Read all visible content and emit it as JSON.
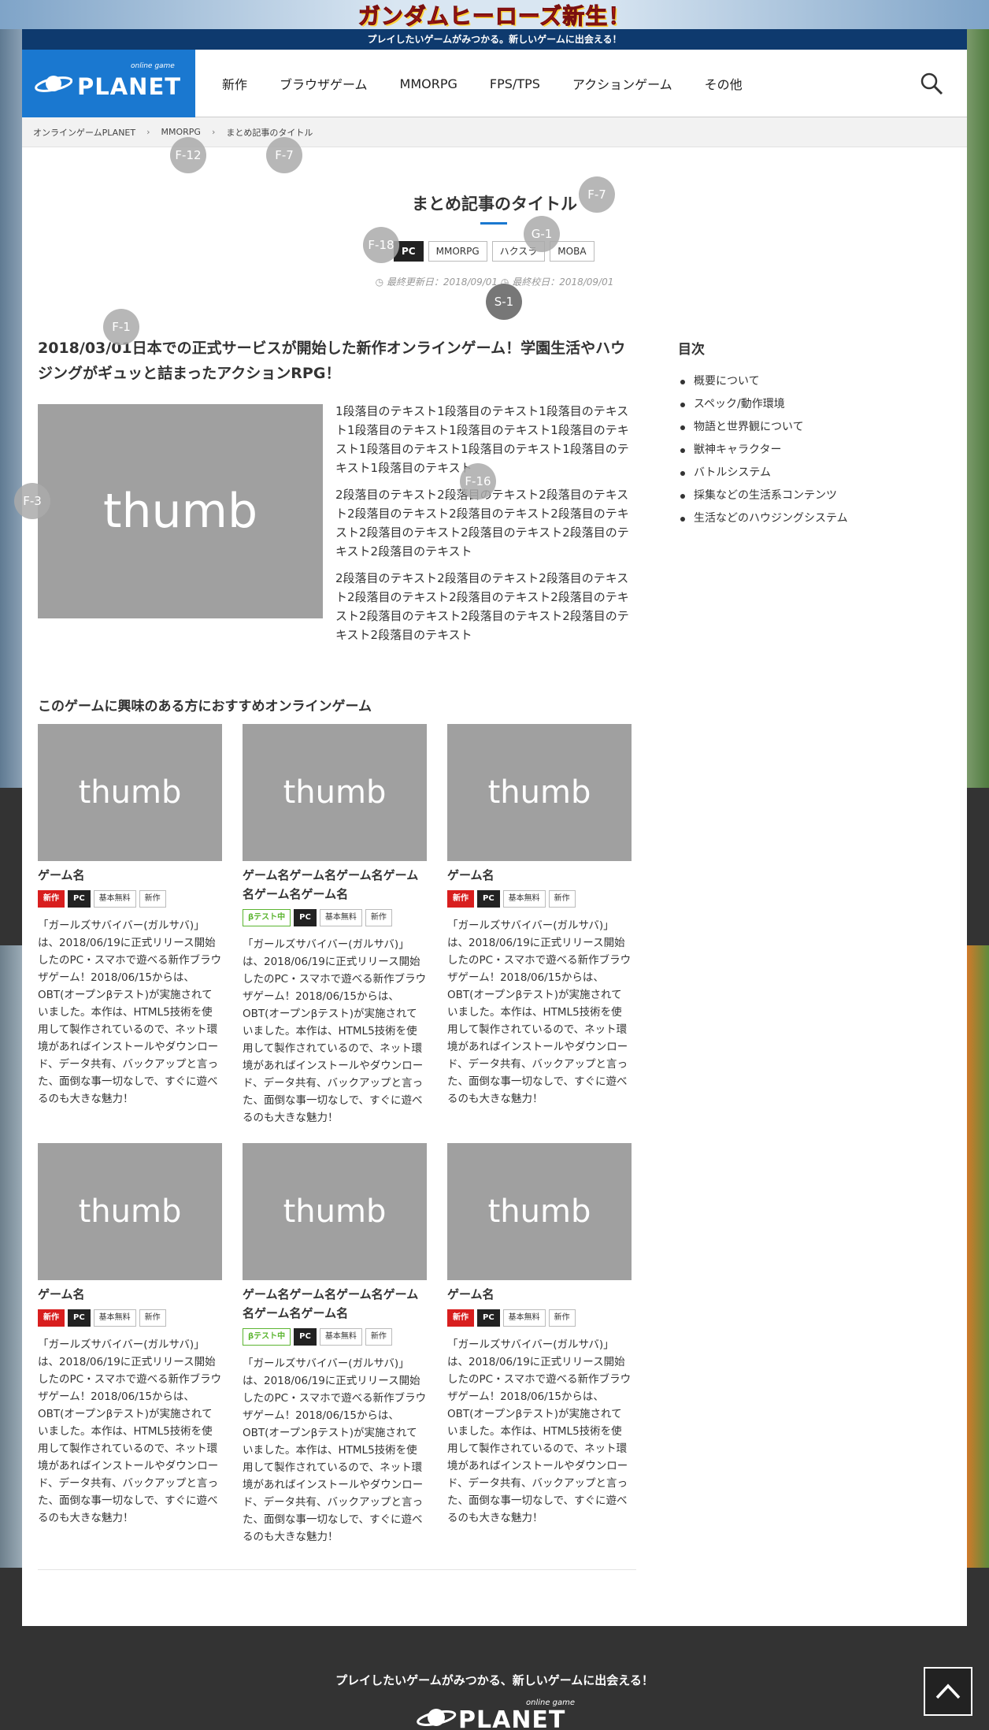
{
  "banner": {
    "text": "ガンダムヒーローズ新生！"
  },
  "tagline": "プレイしたいゲームがみつかる。新しいゲームに出会える！",
  "logo": {
    "sub": "online game",
    "text": "PLANET"
  },
  "nav": [
    "新作",
    "ブラウザゲーム",
    "MMORPG",
    "FPS/TPS",
    "アクションゲーム",
    "その他"
  ],
  "breadcrumb": [
    "オンラインゲームPLANET",
    "MMORPG",
    "まとめ記事のタイトル"
  ],
  "badges": [
    "F-12",
    "F-7",
    "F-7",
    "F-18",
    "G-1",
    "S-1",
    "F-1",
    "F-3",
    "F-16"
  ],
  "article": {
    "title": "まとめ記事のタイトル",
    "tags": [
      "PC",
      "MMORPG",
      "ハクスラ",
      "MOBA"
    ],
    "updated": "最終更新日：2018/09/01",
    "proofread": "最終校日：2018/09/01",
    "lead": "2018/03/01日本での正式サービスが開始した新作オンラインゲーム！学園生活やハウジングがギュッと詰まったアクションRPG！",
    "thumb": "thumb",
    "paragraphs": [
      "1段落目のテキスト1段落目のテキスト1段落目のテキスト1段落目のテキスト1段落目のテキスト1段落目のテキスト1段落目のテキスト1段落目のテキスト1段落目のテキスト1段落目のテキスト",
      "2段落目のテキスト2段落目のテキスト2段落目のテキスト2段落目のテキスト2段落目のテキスト2段落目のテキスト2段落目のテキスト2段落目のテキスト2段落目のテキスト2段落目のテキスト",
      "2段落目のテキスト2段落目のテキスト2段落目のテキスト2段落目のテキスト2段落目のテキスト2段落目のテキスト2段落目のテキスト2段落目のテキスト2段落目のテキスト2段落目のテキスト"
    ]
  },
  "toc": {
    "heading": "目次",
    "items": [
      "概要について",
      "スペック/動作環境",
      "物語と世界観について",
      "獣神キャラクター",
      "バトルシステム",
      "採集などの生活系コンテンツ",
      "生活などのハウジングシステム"
    ]
  },
  "recommend": {
    "heading": "このゲームに興味のある方におすすめオンラインゲーム",
    "cards": [
      {
        "thumb": "thumb",
        "name": "ゲーム名",
        "tags": [
          "新作",
          "PC",
          "基本無料",
          "新作"
        ],
        "desc": "「ガールズサバイバー(ガルサバ)」は、2018/06/19に正式リリース開始したのPC・スマホで遊べる新作ブラウザゲーム！2018/06/15からは、OBT(オープンβテスト)が実施されていました。本作は、HTML5技術を使用して製作されているので、ネット環境があればインストールやダウンロード、データ共有、バックアップと言った、面倒な事一切なしで、すぐに遊べるのも大きな魅力！"
      },
      {
        "thumb": "thumb",
        "name": "ゲーム名ゲーム名ゲーム名ゲーム名ゲーム名ゲーム名",
        "tags": [
          "βテスト中",
          "PC",
          "基本無料",
          "新作"
        ],
        "desc": "「ガールズサバイバー(ガルサバ)」は、2018/06/19に正式リリース開始したのPC・スマホで遊べる新作ブラウザゲーム！2018/06/15からは、OBT(オープンβテスト)が実施されていました。本作は、HTML5技術を使用して製作されているので、ネット環境があればインストールやダウンロード、データ共有、バックアップと言った、面倒な事一切なしで、すぐに遊べるのも大きな魅力！"
      },
      {
        "thumb": "thumb",
        "name": "ゲーム名",
        "tags": [
          "新作",
          "PC",
          "基本無料",
          "新作"
        ],
        "desc": "「ガールズサバイバー(ガルサバ)」は、2018/06/19に正式リリース開始したのPC・スマホで遊べる新作ブラウザゲーム！2018/06/15からは、OBT(オープンβテスト)が実施されていました。本作は、HTML5技術を使用して製作されているので、ネット環境があればインストールやダウンロード、データ共有、バックアップと言った、面倒な事一切なしで、すぐに遊べるのも大きな魅力！"
      },
      {
        "thumb": "thumb",
        "name": "ゲーム名",
        "tags": [
          "新作",
          "PC",
          "基本無料",
          "新作"
        ],
        "desc": "「ガールズサバイバー(ガルサバ)」は、2018/06/19に正式リリース開始したのPC・スマホで遊べる新作ブラウザゲーム！2018/06/15からは、OBT(オープンβテスト)が実施されていました。本作は、HTML5技術を使用して製作されているので、ネット環境があればインストールやダウンロード、データ共有、バックアップと言った、面倒な事一切なしで、すぐに遊べるのも大きな魅力！"
      },
      {
        "thumb": "thumb",
        "name": "ゲーム名ゲーム名ゲーム名ゲーム名ゲーム名ゲーム名",
        "tags": [
          "βテスト中",
          "PC",
          "基本無料",
          "新作"
        ],
        "desc": "「ガールズサバイバー(ガルサバ)」は、2018/06/19に正式リリース開始したのPC・スマホで遊べる新作ブラウザゲーム！2018/06/15からは、OBT(オープンβテスト)が実施されていました。本作は、HTML5技術を使用して製作されているので、ネット環境があればインストールやダウンロード、データ共有、バックアップと言った、面倒な事一切なしで、すぐに遊べるのも大きな魅力！"
      },
      {
        "thumb": "thumb",
        "name": "ゲーム名",
        "tags": [
          "新作",
          "PC",
          "基本無料",
          "新作"
        ],
        "desc": "「ガールズサバイバー(ガルサバ)」は、2018/06/19に正式リリース開始したのPC・スマホで遊べる新作ブラウザゲーム！2018/06/15からは、OBT(オープンβテスト)が実施されていました。本作は、HTML5技術を使用して製作されているので、ネット環境があればインストールやダウンロード、データ共有、バックアップと言った、面倒な事一切なしで、すぐに遊べるのも大きな魅力！"
      }
    ]
  },
  "footer": {
    "tagline": "プレイしたいゲームがみつかる、新しいゲームに出会える！",
    "logo_sub": "online game",
    "logo_text": "PLANET"
  },
  "icons": {
    "search": "search-icon",
    "top": "arrow-up-icon",
    "logo": "planet-ring-icon",
    "clock": "clock-icon"
  },
  "colors": {
    "brand": "#1a78d0",
    "navy": "#0e3a6e",
    "new": "#d81e1e",
    "beta": "#5cb531"
  }
}
